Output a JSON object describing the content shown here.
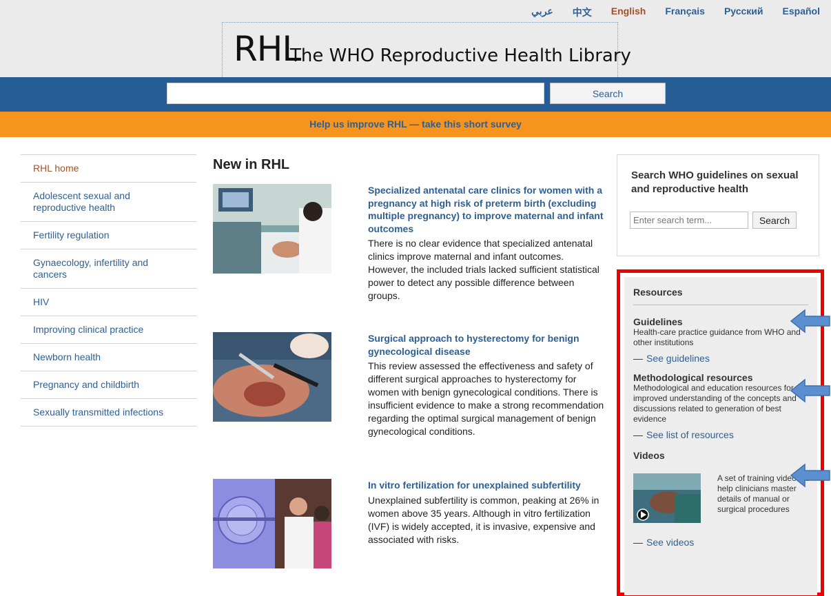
{
  "languages": [
    {
      "label": "عربي",
      "active": false
    },
    {
      "label": "中文",
      "active": false
    },
    {
      "label": "English",
      "active": true
    },
    {
      "label": "Français",
      "active": false
    },
    {
      "label": "Русский",
      "active": false
    },
    {
      "label": "Español",
      "active": false
    }
  ],
  "logo": {
    "short": "RHL",
    "full": "The WHO Reproductive Health Library"
  },
  "search": {
    "value": "",
    "button": "Search"
  },
  "survey": "Help us improve RHL — take this short survey",
  "nav": [
    {
      "label": "RHL home",
      "active": true
    },
    {
      "label": "Adolescent sexual and reproductive health",
      "active": false
    },
    {
      "label": "Fertility regulation",
      "active": false
    },
    {
      "label": "Gynaecology, infertility and cancers",
      "active": false
    },
    {
      "label": "HIV",
      "active": false
    },
    {
      "label": "Improving clinical practice",
      "active": false
    },
    {
      "label": "Newborn health",
      "active": false
    },
    {
      "label": "Pregnancy and childbirth",
      "active": false
    },
    {
      "label": "Sexually transmitted infections",
      "active": false
    }
  ],
  "main": {
    "heading": "New in RHL",
    "articles": [
      {
        "title": "Specialized antenatal care clinics for women with a pregnancy at high risk of preterm birth (excluding multiple pregnancy) to improve maternal and infant outcomes",
        "text": "There is no clear evidence that specialized antenatal clinics improve maternal and infant outcomes. However, the included trials lacked sufficient statistical power to detect any possible difference between groups."
      },
      {
        "title": "Surgical approach to hysterectomy for benign gynecological disease",
        "text": "This review assessed the effectiveness and safety of different surgical approaches to hysterectomy for women with benign gynecological conditions. There is insufficient evidence to make a strong recommendation regarding the optimal surgical management of benign gynecological conditions."
      },
      {
        "title": "In vitro fertilization for unexplained subfertility",
        "text": "Unexplained subfertility is common, peaking at 26% in women above 35 years. Although in vitro fertilization (IVF) is widely accepted, it is invasive, expensive and associated with risks."
      }
    ]
  },
  "who_search": {
    "title": "Search WHO guidelines on sexual and reproductive health",
    "placeholder": "Enter search term...",
    "button": "Search"
  },
  "resources": {
    "heading": "Resources",
    "guidelines": {
      "title": "Guidelines",
      "desc": "Health-care practice guidance from WHO and other institutions",
      "link": "See guidelines"
    },
    "methodological": {
      "title": "Methodological resources",
      "desc": "Methodological and education resources for improved understanding of the concepts and discussions related to generation of best evidence",
      "link": "See list of resources"
    },
    "videos": {
      "title": "Videos",
      "desc": "A set of training videos to help clinicians master details of manual or surgical procedures",
      "link": "See videos"
    },
    "dash": "—"
  },
  "colors": {
    "link": "#2e5f93",
    "active": "#a0522d",
    "blue_bar": "#265d94",
    "orange_bar": "#f7941d",
    "highlight": "#ee0000",
    "arrow": "#5b8fd0"
  }
}
